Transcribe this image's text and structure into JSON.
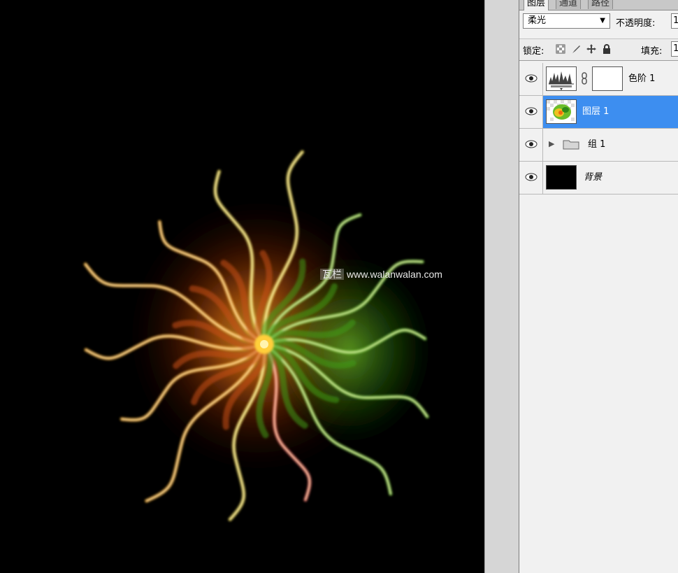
{
  "canvas": {
    "watermark_logo": "瓦栏",
    "watermark_text": "www.walanwalan.com"
  },
  "panel": {
    "tabs": [
      {
        "label": "图层",
        "active": true
      },
      {
        "label": "通道",
        "active": false
      },
      {
        "label": "路径",
        "active": false
      }
    ],
    "blend_mode": "柔光",
    "opacity_label": "不透明度:",
    "opacity_value": "1",
    "lock_label": "锁定:",
    "fill_label": "填充:",
    "fill_value": "1",
    "layers": [
      {
        "name": "色阶 1",
        "type": "adjustment",
        "visible": true,
        "selected": false
      },
      {
        "name": "图层 1",
        "type": "pixel",
        "visible": true,
        "selected": true
      },
      {
        "name": "组 1",
        "type": "group",
        "visible": true,
        "selected": false
      },
      {
        "name": "背景",
        "type": "background",
        "visible": true,
        "selected": false
      }
    ]
  },
  "colors": {
    "selection": "#3d8ef0",
    "panel_bg": "#f1f1f1",
    "canvas_bg": "#000000"
  }
}
